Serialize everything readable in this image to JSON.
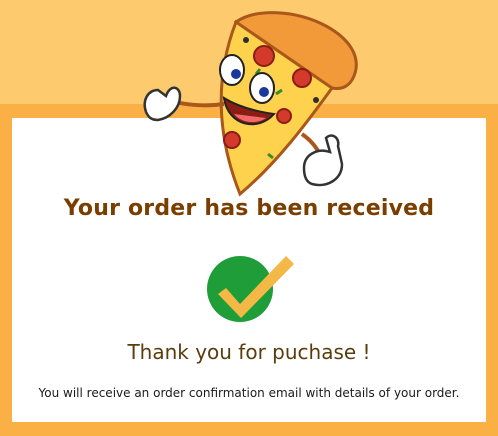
{
  "heading": "Your order has been received",
  "thanks": "Thank you for puchase !",
  "message": "You will receive an order confirmation email with details of your order.",
  "colors": {
    "page_bg": "#fdcb6e",
    "card_border": "#fbb046",
    "heading": "#7a3e00",
    "check_circle": "#1f9d38",
    "check_mark": "#f3b845"
  },
  "icons": {
    "mascot": "pizza-slice-mascot-icon",
    "check": "checkmark-circle-icon"
  }
}
